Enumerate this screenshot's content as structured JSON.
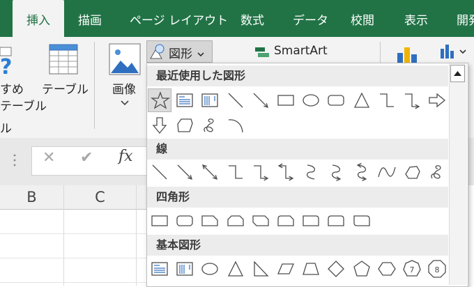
{
  "ribbon_tabs": [
    "挿入",
    "描画",
    "ページ レイアウト",
    "数式",
    "データ",
    "校閲",
    "表示",
    "開発"
  ],
  "ribbon": {
    "recommended_top": "すめ",
    "recommended_bottom": "テーブル",
    "table_group_label": "ル",
    "table_label": "テーブル",
    "image_label": "画像",
    "shapes_label": "図形",
    "smartart_label": "SmartArt"
  },
  "formula_bar": {
    "cancel": "✕",
    "enter": "✔",
    "fx": "fx"
  },
  "columns": [
    "B",
    "C"
  ],
  "shapes_panel": {
    "sections": [
      {
        "title": "最近使用した図形",
        "rows": [
          [
            "star",
            "textbox",
            "vtextbox",
            "line",
            "arrow-line",
            "rect",
            "oval",
            "rounded-rect",
            "triangle",
            "elbow",
            "elbow-arrow",
            "right-arrow"
          ],
          [
            "down-arrow",
            "snip-shape",
            "scribble",
            "arc"
          ]
        ]
      },
      {
        "title": "線",
        "rows": [
          [
            "line",
            "arrow-line",
            "double-arrow",
            "elbow",
            "elbow-arrow",
            "elbow-double-arrow",
            "curve",
            "curve-arrow",
            "curve-double-arrow",
            "freeform-curve",
            "freeform",
            "scribble"
          ]
        ]
      },
      {
        "title": "四角形",
        "rows": [
          [
            "rect",
            "rounded-rect",
            "snip1-rect",
            "snip2-same",
            "snip2-diag",
            "snip-round",
            "round1",
            "round2-same",
            "round2-diag"
          ]
        ]
      },
      {
        "title": "基本図形",
        "rows": [
          [
            "textbox",
            "vtextbox",
            "oval",
            "triangle",
            "right-triangle",
            "parallelogram",
            "trapezoid",
            "diamond",
            "pentagon",
            "hexagon",
            "heptagon",
            "octagon"
          ]
        ]
      }
    ],
    "heptagon_label": "7",
    "octagon_label": "8"
  },
  "colors": {
    "accent": "#217346",
    "ribbon_bg": "#f3f3f3",
    "selected_shape_bg": "#dcdcdc"
  }
}
